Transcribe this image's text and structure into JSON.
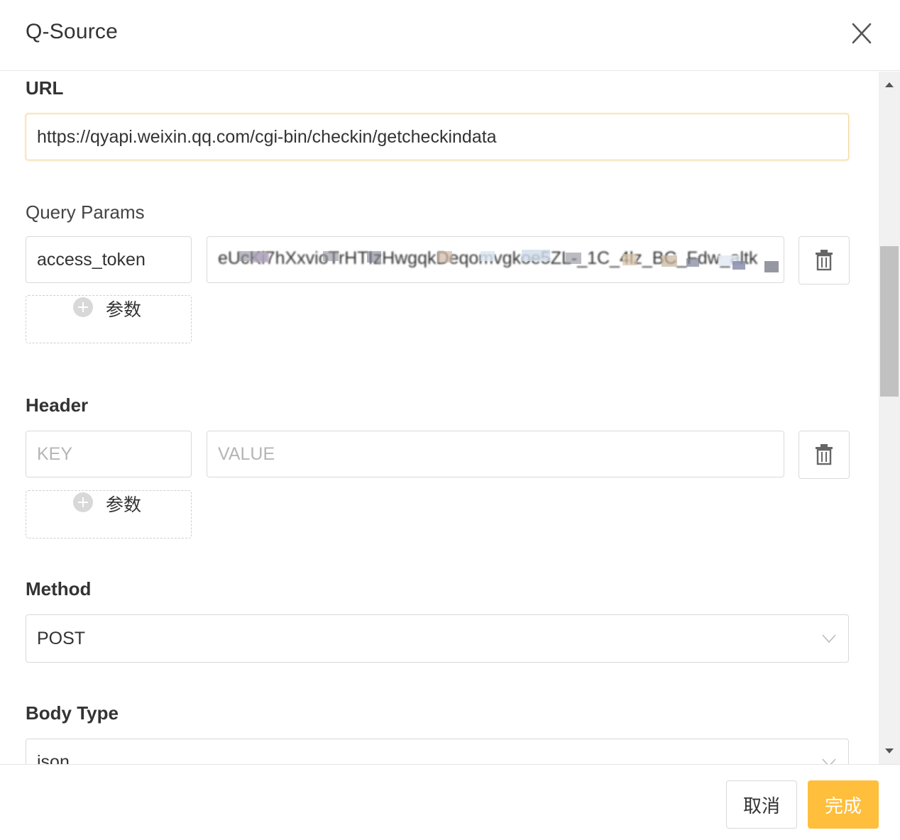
{
  "dialog": {
    "title": "Q-Source",
    "close_icon": "close-icon"
  },
  "url_section": {
    "label": "URL",
    "value": "https://qyapi.weixin.qq.com/cgi-bin/checkin/getcheckindata"
  },
  "query_params": {
    "label": "Query Params",
    "rows": [
      {
        "key": "access_token",
        "value": ""
      }
    ],
    "add_label": "参数",
    "delete_icon": "trash-icon",
    "add_icon": "plus-circle-icon"
  },
  "header_section": {
    "label": "Header",
    "key_placeholder": "KEY",
    "value_placeholder": "VALUE",
    "add_label": "参数",
    "delete_icon": "trash-icon"
  },
  "method_section": {
    "label": "Method",
    "selected": "POST",
    "chevron_icon": "chevron-down-icon"
  },
  "body_type_section": {
    "label": "Body Type",
    "selected": "json"
  },
  "footer": {
    "cancel_label": "取消",
    "confirm_label": "完成"
  },
  "colors": {
    "primary": "#ffbe3b",
    "focus_border": "#f4d49a",
    "border": "#d9d9d9"
  }
}
